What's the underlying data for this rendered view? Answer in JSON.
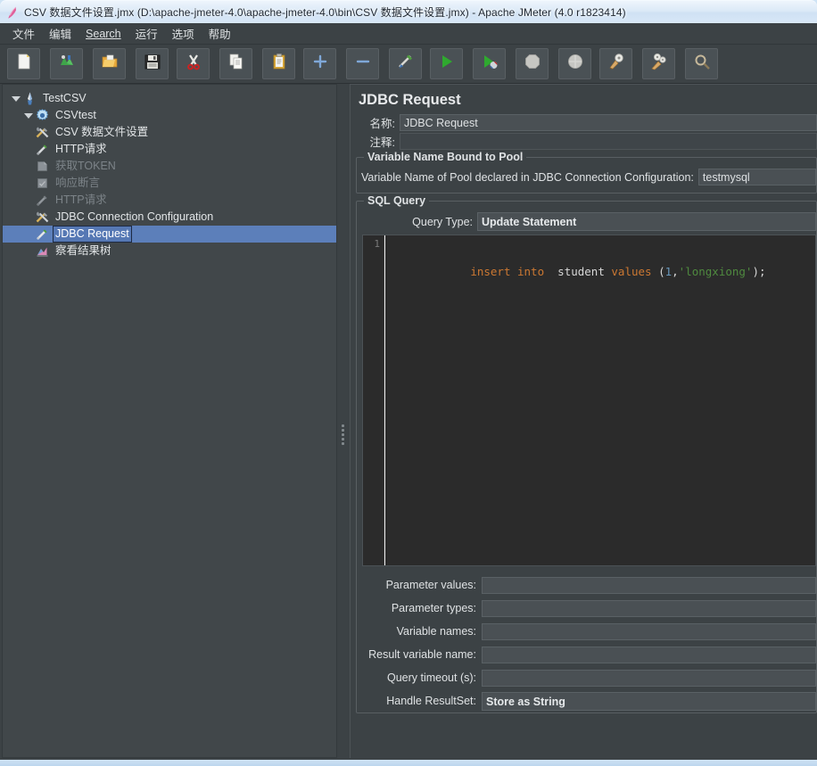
{
  "window": {
    "title": "CSV 数据文件设置.jmx (D:\\apache-jmeter-4.0\\apache-jmeter-4.0\\bin\\CSV 数据文件设置.jmx) - Apache JMeter (4.0 r1823414)",
    "app_icon": "jmeter-feather-icon"
  },
  "menubar": {
    "items": [
      {
        "label": "文件",
        "mnemonic": ""
      },
      {
        "label": "编辑",
        "mnemonic": ""
      },
      {
        "label": "Search",
        "mnemonic": "S"
      },
      {
        "label": "运行",
        "mnemonic": ""
      },
      {
        "label": "选项",
        "mnemonic": ""
      },
      {
        "label": "帮助",
        "mnemonic": ""
      }
    ]
  },
  "toolbar": {
    "buttons": [
      {
        "name": "new-test-plan-button",
        "icon": "new-document-icon"
      },
      {
        "name": "templates-button",
        "icon": "templates-icon"
      },
      {
        "name": "open-button",
        "icon": "open-folder-icon"
      },
      {
        "name": "save-button",
        "icon": "floppy-disk-icon"
      },
      {
        "name": "cut-button",
        "icon": "scissors-icon"
      },
      {
        "name": "copy-button",
        "icon": "copy-pages-icon"
      },
      {
        "name": "paste-button",
        "icon": "clipboard-icon"
      },
      {
        "name": "expand-all-button",
        "icon": "plus-icon"
      },
      {
        "name": "collapse-all-button",
        "icon": "minus-icon"
      },
      {
        "name": "toggle-button",
        "icon": "toggle-pencil-icon"
      },
      {
        "name": "start-button",
        "icon": "play-triangle-icon"
      },
      {
        "name": "start-no-pauses-button",
        "icon": "play-nopause-icon"
      },
      {
        "name": "stop-button",
        "icon": "stop-octagon-icon"
      },
      {
        "name": "shutdown-button",
        "icon": "shutdown-circle-icon"
      },
      {
        "name": "clear-button",
        "icon": "clear-broom-icon"
      },
      {
        "name": "clear-all-button",
        "icon": "clear-all-broom-icon"
      },
      {
        "name": "search-toolbar-button",
        "icon": "magnifier-icon"
      }
    ]
  },
  "tree": {
    "nodes": [
      {
        "label": "TestCSV",
        "icon": "test-plan-icon",
        "indent": 0,
        "expanded": true,
        "selected": false,
        "disabled": false
      },
      {
        "label": "CSVtest",
        "icon": "thread-group-gear-icon",
        "indent": 1,
        "expanded": true,
        "selected": false,
        "disabled": false
      },
      {
        "label": "CSV 数据文件设置",
        "icon": "config-element-icon",
        "indent": 2,
        "expanded": null,
        "selected": false,
        "disabled": false
      },
      {
        "label": "HTTP请求",
        "icon": "sampler-pencil-icon",
        "indent": 2,
        "expanded": null,
        "selected": false,
        "disabled": false
      },
      {
        "label": "获取TOKEN",
        "icon": "post-processor-icon",
        "indent": 2,
        "expanded": null,
        "selected": false,
        "disabled": true
      },
      {
        "label": "响应断言",
        "icon": "assertion-icon",
        "indent": 2,
        "expanded": null,
        "selected": false,
        "disabled": true
      },
      {
        "label": "HTTP请求",
        "icon": "sampler-pencil-icon",
        "indent": 2,
        "expanded": null,
        "selected": false,
        "disabled": true
      },
      {
        "label": "JDBC Connection Configuration",
        "icon": "config-element-icon",
        "indent": 2,
        "expanded": null,
        "selected": false,
        "disabled": false
      },
      {
        "label": "JDBC Request",
        "icon": "sampler-pencil-icon",
        "indent": 2,
        "expanded": null,
        "selected": true,
        "disabled": false
      },
      {
        "label": "察看结果树",
        "icon": "listener-chart-icon",
        "indent": 2,
        "expanded": null,
        "selected": false,
        "disabled": false
      }
    ]
  },
  "panel": {
    "title": "JDBC Request",
    "name_label": "名称:",
    "name_value": "JDBC Request",
    "comment_label": "注释:",
    "comment_value": "",
    "pool_group_title": "Variable Name Bound to Pool",
    "pool_label": "Variable Name of Pool declared in JDBC Connection Configuration:",
    "pool_value": "testmysql",
    "sql_group_title": "SQL Query",
    "query_type_label": "Query Type:",
    "query_type_value": "Update Statement",
    "sql_line_number": "1",
    "sql_tokens": [
      {
        "text": "insert",
        "type": "kw"
      },
      {
        "text": " ",
        "type": "punct"
      },
      {
        "text": "into",
        "type": "kw"
      },
      {
        "text": "  ",
        "type": "punct"
      },
      {
        "text": "student",
        "type": "ident"
      },
      {
        "text": " ",
        "type": "punct"
      },
      {
        "text": "values",
        "type": "kw"
      },
      {
        "text": " (",
        "type": "punct"
      },
      {
        "text": "1",
        "type": "num"
      },
      {
        "text": ",",
        "type": "punct"
      },
      {
        "text": "'longxiong'",
        "type": "str"
      },
      {
        "text": ");",
        "type": "punct"
      }
    ],
    "sql_plain": "insert into  student values (1,'longxiong');",
    "params": [
      {
        "label": "Parameter values:",
        "value": "",
        "kind": "input"
      },
      {
        "label": "Parameter types:",
        "value": "",
        "kind": "input"
      },
      {
        "label": "Variable names:",
        "value": "",
        "kind": "input"
      },
      {
        "label": "Result variable name:",
        "value": "",
        "kind": "input"
      },
      {
        "label": "Query timeout (s):",
        "value": "",
        "kind": "input"
      },
      {
        "label": "Handle ResultSet:",
        "value": "Store as String",
        "kind": "combo"
      }
    ]
  },
  "colors": {
    "panel_bg": "#3c4245",
    "tree_bg": "#41474a",
    "field_bg": "#4a5054",
    "selection": "#5c7fba",
    "text": "#dfe2e4",
    "disabled_text": "#7c8388",
    "editor_bg": "#2b2b2b",
    "keyword": "#cc7832",
    "string": "#4f8a3f",
    "number": "#6897bb",
    "titlebar": "#d9e8f7"
  }
}
